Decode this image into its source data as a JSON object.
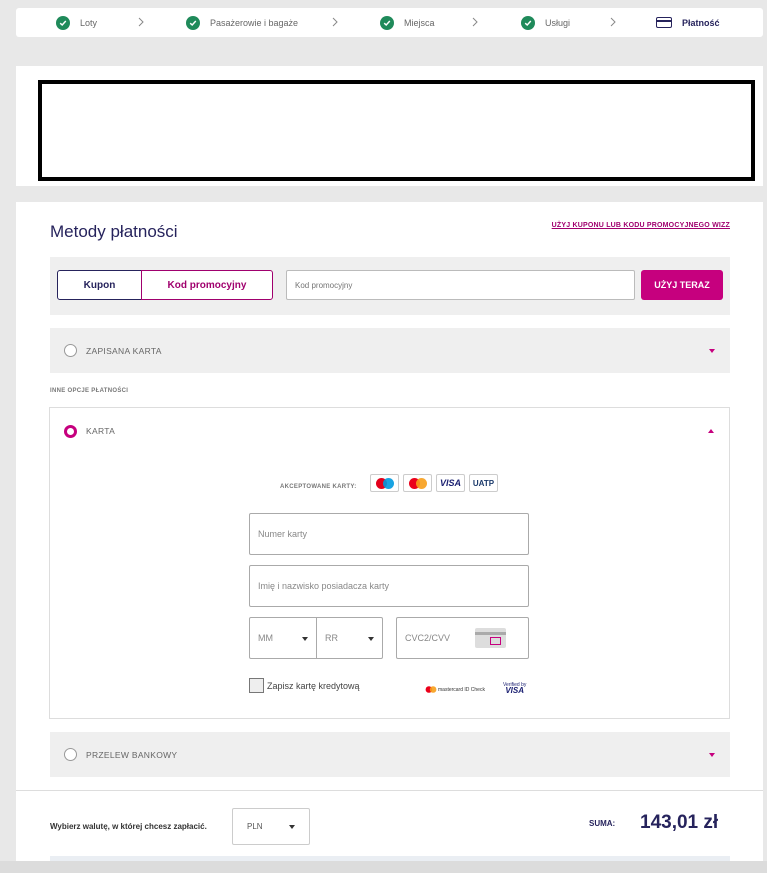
{
  "stepper": {
    "steps": [
      {
        "label": "Loty"
      },
      {
        "label": "Pasażerowie i bagaże"
      },
      {
        "label": "Miejsca"
      },
      {
        "label": "Usługi"
      },
      {
        "label": "Płatność"
      }
    ]
  },
  "payment": {
    "title": "Metody płatności",
    "coupon_link": "UŻYJ KUPONU LUB KODU PROMOCYJNEGO WIZZ",
    "tab_kupon": "Kupon",
    "tab_kod": "Kod promocyjny",
    "promo_placeholder": "Kod promocyjny",
    "use_button": "UŻYJ TERAZ",
    "saved_card": "ZAPISANA KARTA",
    "other_options": "INNE OPCJE PŁATNOŚCI",
    "card": "KARTA",
    "accepted_cards": "AKCEPTOWANE KARTY:",
    "card_logos": {
      "visa": "VISA",
      "uatp": "UATP"
    },
    "card_number_placeholder": "Numer karty",
    "cardholder_placeholder": "Imię i nazwisko posiadacza karty",
    "month": "MM",
    "year": "RR",
    "cvc_placeholder": "CVC2/CVV",
    "save_card": "Zapisz kartę kredytową",
    "mc_id_check": "mastercard ID Check",
    "verified_by": "Verified by",
    "verified_visa": "VISA",
    "bank_transfer": "PRZELEW BANKOWY"
  },
  "footer": {
    "currency_label": "Wybierz walutę, w której chcesz zapłacić.",
    "currency_value": "PLN",
    "sum_label": "SUMA:",
    "sum_value": "143,01 zł"
  },
  "colors": {
    "brand_magenta": "#c6007e",
    "brand_navy": "#26235c",
    "check_green": "#1f8a5a"
  }
}
